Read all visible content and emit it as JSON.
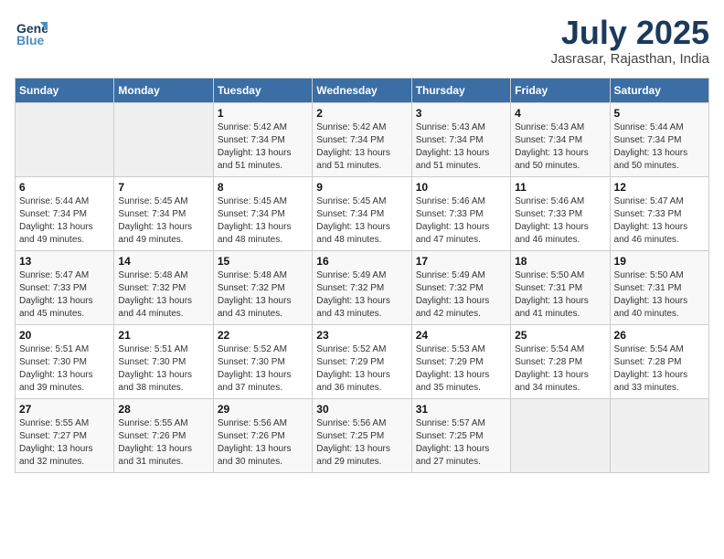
{
  "header": {
    "logo_line1": "General",
    "logo_line2": "Blue",
    "month_year": "July 2025",
    "location": "Jasrasar, Rajasthan, India"
  },
  "weekdays": [
    "Sunday",
    "Monday",
    "Tuesday",
    "Wednesday",
    "Thursday",
    "Friday",
    "Saturday"
  ],
  "weeks": [
    [
      {
        "day": "",
        "info": ""
      },
      {
        "day": "",
        "info": ""
      },
      {
        "day": "1",
        "info": "Sunrise: 5:42 AM\nSunset: 7:34 PM\nDaylight: 13 hours\nand 51 minutes."
      },
      {
        "day": "2",
        "info": "Sunrise: 5:42 AM\nSunset: 7:34 PM\nDaylight: 13 hours\nand 51 minutes."
      },
      {
        "day": "3",
        "info": "Sunrise: 5:43 AM\nSunset: 7:34 PM\nDaylight: 13 hours\nand 51 minutes."
      },
      {
        "day": "4",
        "info": "Sunrise: 5:43 AM\nSunset: 7:34 PM\nDaylight: 13 hours\nand 50 minutes."
      },
      {
        "day": "5",
        "info": "Sunrise: 5:44 AM\nSunset: 7:34 PM\nDaylight: 13 hours\nand 50 minutes."
      }
    ],
    [
      {
        "day": "6",
        "info": "Sunrise: 5:44 AM\nSunset: 7:34 PM\nDaylight: 13 hours\nand 49 minutes."
      },
      {
        "day": "7",
        "info": "Sunrise: 5:45 AM\nSunset: 7:34 PM\nDaylight: 13 hours\nand 49 minutes."
      },
      {
        "day": "8",
        "info": "Sunrise: 5:45 AM\nSunset: 7:34 PM\nDaylight: 13 hours\nand 48 minutes."
      },
      {
        "day": "9",
        "info": "Sunrise: 5:45 AM\nSunset: 7:34 PM\nDaylight: 13 hours\nand 48 minutes."
      },
      {
        "day": "10",
        "info": "Sunrise: 5:46 AM\nSunset: 7:33 PM\nDaylight: 13 hours\nand 47 minutes."
      },
      {
        "day": "11",
        "info": "Sunrise: 5:46 AM\nSunset: 7:33 PM\nDaylight: 13 hours\nand 46 minutes."
      },
      {
        "day": "12",
        "info": "Sunrise: 5:47 AM\nSunset: 7:33 PM\nDaylight: 13 hours\nand 46 minutes."
      }
    ],
    [
      {
        "day": "13",
        "info": "Sunrise: 5:47 AM\nSunset: 7:33 PM\nDaylight: 13 hours\nand 45 minutes."
      },
      {
        "day": "14",
        "info": "Sunrise: 5:48 AM\nSunset: 7:32 PM\nDaylight: 13 hours\nand 44 minutes."
      },
      {
        "day": "15",
        "info": "Sunrise: 5:48 AM\nSunset: 7:32 PM\nDaylight: 13 hours\nand 43 minutes."
      },
      {
        "day": "16",
        "info": "Sunrise: 5:49 AM\nSunset: 7:32 PM\nDaylight: 13 hours\nand 43 minutes."
      },
      {
        "day": "17",
        "info": "Sunrise: 5:49 AM\nSunset: 7:32 PM\nDaylight: 13 hours\nand 42 minutes."
      },
      {
        "day": "18",
        "info": "Sunrise: 5:50 AM\nSunset: 7:31 PM\nDaylight: 13 hours\nand 41 minutes."
      },
      {
        "day": "19",
        "info": "Sunrise: 5:50 AM\nSunset: 7:31 PM\nDaylight: 13 hours\nand 40 minutes."
      }
    ],
    [
      {
        "day": "20",
        "info": "Sunrise: 5:51 AM\nSunset: 7:30 PM\nDaylight: 13 hours\nand 39 minutes."
      },
      {
        "day": "21",
        "info": "Sunrise: 5:51 AM\nSunset: 7:30 PM\nDaylight: 13 hours\nand 38 minutes."
      },
      {
        "day": "22",
        "info": "Sunrise: 5:52 AM\nSunset: 7:30 PM\nDaylight: 13 hours\nand 37 minutes."
      },
      {
        "day": "23",
        "info": "Sunrise: 5:52 AM\nSunset: 7:29 PM\nDaylight: 13 hours\nand 36 minutes."
      },
      {
        "day": "24",
        "info": "Sunrise: 5:53 AM\nSunset: 7:29 PM\nDaylight: 13 hours\nand 35 minutes."
      },
      {
        "day": "25",
        "info": "Sunrise: 5:54 AM\nSunset: 7:28 PM\nDaylight: 13 hours\nand 34 minutes."
      },
      {
        "day": "26",
        "info": "Sunrise: 5:54 AM\nSunset: 7:28 PM\nDaylight: 13 hours\nand 33 minutes."
      }
    ],
    [
      {
        "day": "27",
        "info": "Sunrise: 5:55 AM\nSunset: 7:27 PM\nDaylight: 13 hours\nand 32 minutes."
      },
      {
        "day": "28",
        "info": "Sunrise: 5:55 AM\nSunset: 7:26 PM\nDaylight: 13 hours\nand 31 minutes."
      },
      {
        "day": "29",
        "info": "Sunrise: 5:56 AM\nSunset: 7:26 PM\nDaylight: 13 hours\nand 30 minutes."
      },
      {
        "day": "30",
        "info": "Sunrise: 5:56 AM\nSunset: 7:25 PM\nDaylight: 13 hours\nand 29 minutes."
      },
      {
        "day": "31",
        "info": "Sunrise: 5:57 AM\nSunset: 7:25 PM\nDaylight: 13 hours\nand 27 minutes."
      },
      {
        "day": "",
        "info": ""
      },
      {
        "day": "",
        "info": ""
      }
    ]
  ]
}
